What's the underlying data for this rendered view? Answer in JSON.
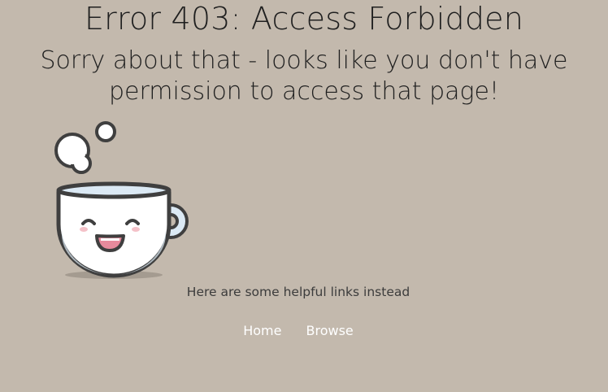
{
  "heading": {
    "title": "Error 403: Access Forbidden",
    "message": "Sorry about that - looks like you don't have permission to access that page!"
  },
  "illustration": {
    "icon": "happy-coffee-cup-icon",
    "colors": {
      "outline": "#3f3f3f",
      "cup": "#ffffff",
      "cup_shade": "#dbe9f4",
      "mouth": "#e78a9c",
      "blush": "#f4c1c8",
      "shadow": "#a49b90"
    }
  },
  "help": {
    "text": "Here are some helpful links instead"
  },
  "links": {
    "home": "Home",
    "browse": "Browse"
  },
  "colors": {
    "background": "#c3b9ad",
    "link": "#ffffff"
  }
}
